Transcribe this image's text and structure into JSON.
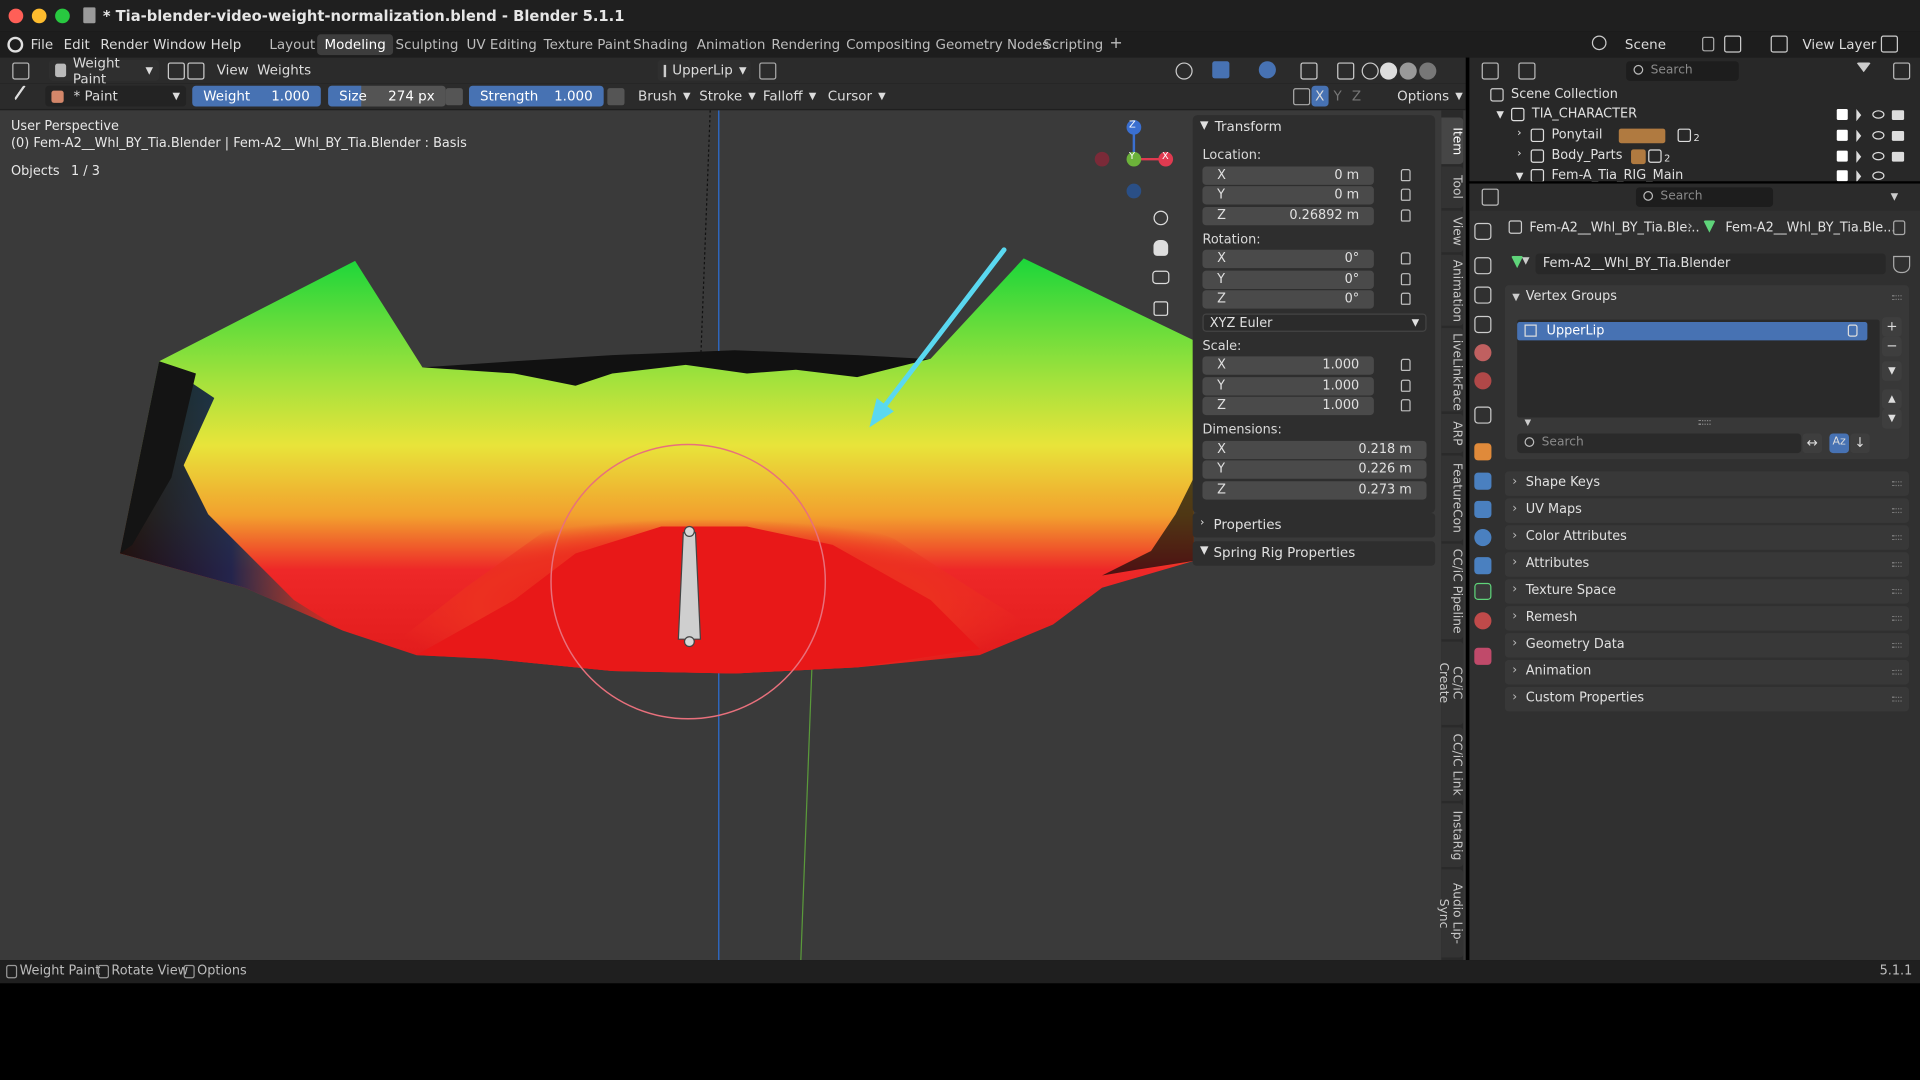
{
  "window": {
    "title": "* Tia-blender-video-weight-normalization.blend - Blender 5.1.1"
  },
  "menubar": {
    "menus": [
      "File",
      "Edit",
      "Render",
      "Window",
      "Help"
    ],
    "workspaces": [
      "Layout",
      "Modeling",
      "Sculpting",
      "UV Editing",
      "Texture Paint",
      "Shading",
      "Animation",
      "Rendering",
      "Compositing",
      "Geometry Nodes",
      "Scripting"
    ],
    "active_workspace": "Modeling",
    "add_workspace": "+",
    "scene": "Scene",
    "view_layer": "View Layer"
  },
  "viewport_header": {
    "mode": "Weight Paint",
    "view": "View",
    "weights": "Weights",
    "vertex_group": "UpperLip"
  },
  "tool_header": {
    "brush_name": "* Paint",
    "weight_label": "Weight",
    "weight_value": "1.000",
    "size_label": "Size",
    "size_value": "274 px",
    "strength_label": "Strength",
    "strength_value": "1.000",
    "brush": "Brush",
    "stroke": "Stroke",
    "falloff": "Falloff",
    "cursor": "Cursor",
    "axis_x": "X",
    "axis_y": "Y",
    "axis_z": "Z",
    "options": "Options"
  },
  "viewport": {
    "perspective": "User Perspective",
    "object_info": "(0) Fem-A2__Whl_BY_Tia.Blender | Fem-A2__Whl_BY_Tia.Blender : Basis",
    "objects_label": "Objects",
    "objects_count": "1 / 3",
    "gizmo_x": "X",
    "gizmo_y": "Y",
    "gizmo_z": "Z"
  },
  "transform_panel": {
    "title": "Transform",
    "location_label": "Location:",
    "location": [
      [
        "X",
        "0 m"
      ],
      [
        "Y",
        "0 m"
      ],
      [
        "Z",
        "0.26892 m"
      ]
    ],
    "rotation_label": "Rotation:",
    "rotation": [
      [
        "X",
        "0°"
      ],
      [
        "Y",
        "0°"
      ],
      [
        "Z",
        "0°"
      ]
    ],
    "rotation_mode": "XYZ Euler",
    "scale_label": "Scale:",
    "scale": [
      [
        "X",
        "1.000"
      ],
      [
        "Y",
        "1.000"
      ],
      [
        "Z",
        "1.000"
      ]
    ],
    "dimensions_label": "Dimensions:",
    "dimensions": [
      [
        "X",
        "0.218 m"
      ],
      [
        "Y",
        "0.226 m"
      ],
      [
        "Z",
        "0.273 m"
      ]
    ],
    "properties": "Properties",
    "spring_rig": "Spring Rig Properties"
  },
  "side_tabs": [
    "Item",
    "Tool",
    "View",
    "Animation",
    "LiveLinkFace",
    "ARP",
    "FeatureCon",
    "CC/iC Pipeline",
    "CC/iC Create",
    "CC/iC Link",
    "InstaRig",
    "Audio Lip-Sync"
  ],
  "outliner": {
    "search_placeholder": "Search",
    "scene_collection": "Scene Collection",
    "rows": [
      "TIA_CHARACTER",
      "Ponytail",
      "Body_Parts",
      "Fem-A_Tia_RIG_Main"
    ],
    "ponytail_badge": "2",
    "body_badge": "2"
  },
  "properties": {
    "search_placeholder": "Search",
    "breadcrumb_object": "Fem-A2__Whl_BY_Tia.Ble...",
    "breadcrumb_mesh": "Fem-A2__Whl_BY_Tia.Ble...",
    "mesh_name": "Fem-A2__Whl_BY_Tia.Blender",
    "vertex_groups_title": "Vertex Groups",
    "vertex_groups": [
      "UpperLip"
    ],
    "vg_search_placeholder": "Search",
    "sections": [
      "Shape Keys",
      "UV Maps",
      "Color Attributes",
      "Attributes",
      "Texture Space",
      "Remesh",
      "Geometry Data",
      "Animation",
      "Custom Properties"
    ]
  },
  "statusbar": {
    "left": [
      "Weight Paint",
      "Rotate View",
      "Options"
    ],
    "version": "5.1.1"
  },
  "colors": {
    "accent": "#4772b3",
    "panel": "#2e2e2e",
    "viewport_bg": "#3a3a3a",
    "annotation_arrow": "#5ad8f0",
    "brush_circle": "#e0707a"
  }
}
